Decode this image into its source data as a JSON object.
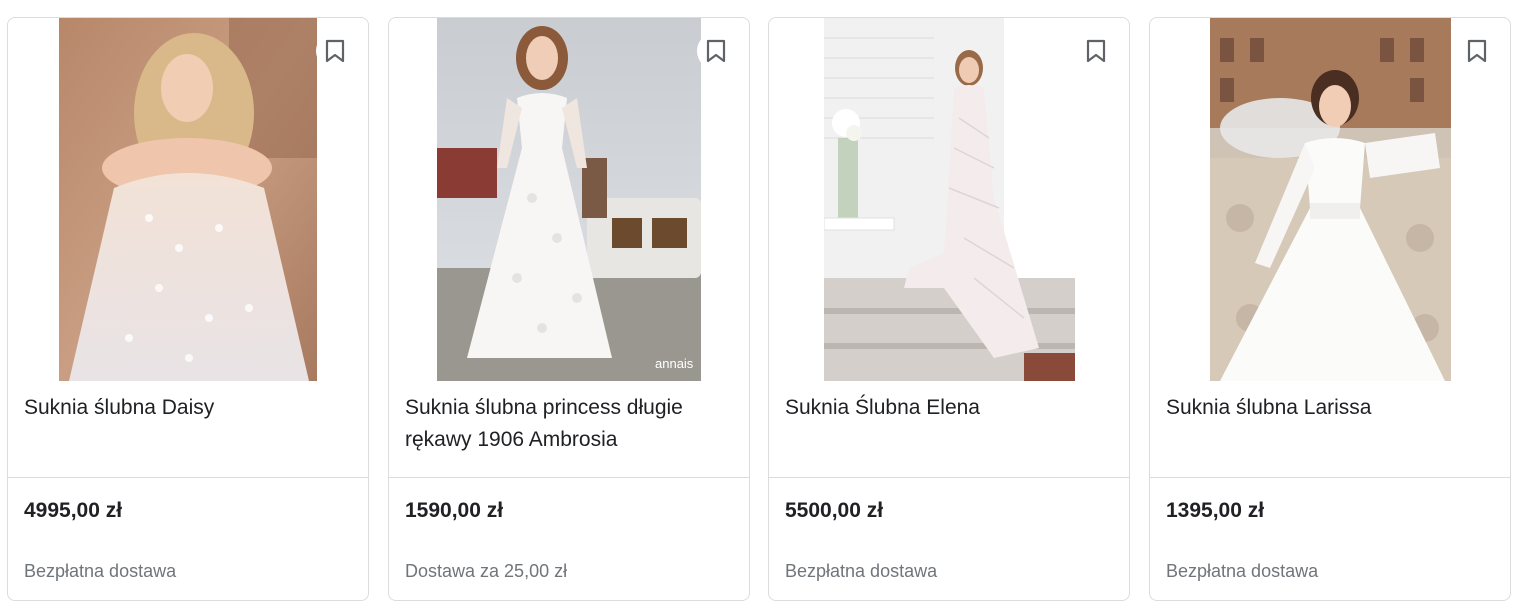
{
  "products": [
    {
      "title": "Suknia ślubna Daisy",
      "price": "4995,00 zł",
      "shipping": "Bezpłatna dostawa",
      "image_icon": "wedding-dress-photo"
    },
    {
      "title": "Suknia ślubna princess długie rękawy 1906 Ambrosia",
      "price": "1590,00 zł",
      "shipping": "Dostawa za 25,00 zł",
      "image_icon": "wedding-dress-photo",
      "image_watermark": "annais"
    },
    {
      "title": "Suknia Ślubna Elena",
      "price": "5500,00 zł",
      "shipping": "Bezpłatna dostawa",
      "image_icon": "wedding-dress-photo"
    },
    {
      "title": "Suknia ślubna Larissa",
      "price": "1395,00 zł",
      "shipping": "Bezpłatna dostawa",
      "image_icon": "wedding-dress-photo"
    }
  ],
  "icons": {
    "bookmark": "bookmark-icon"
  },
  "colors": {
    "border": "#dadce0",
    "text": "#202124",
    "secondary_text": "#70757a"
  }
}
